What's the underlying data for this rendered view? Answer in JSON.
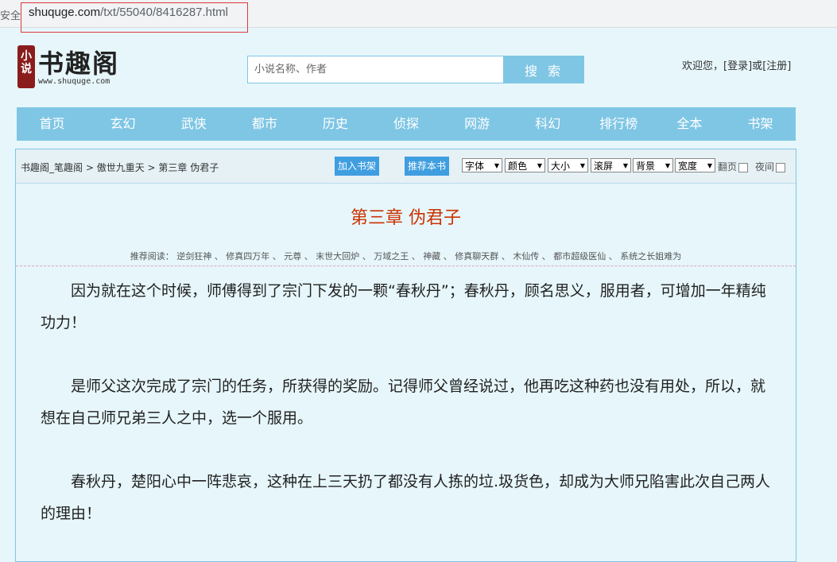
{
  "browser": {
    "security_label": "安全",
    "url_domain": "shuquge.com",
    "url_path": "/txt/55040/8416287.html"
  },
  "header": {
    "logo_seal": "小说",
    "logo_title": "书趣阁",
    "logo_url": "www.shuquge.com",
    "search_placeholder": "小说名称、作者",
    "search_button": "搜 索",
    "welcome": "欢迎您，",
    "login": "[登录]",
    "or": "或",
    "register": "[注册]"
  },
  "nav": [
    "首页",
    "玄幻",
    "武侠",
    "都市",
    "历史",
    "侦探",
    "网游",
    "科幻",
    "排行榜",
    "全本",
    "书架"
  ],
  "toolbar": {
    "crumb_site": "书趣阁_笔趣阁",
    "sep": " > ",
    "crumb_book": "傲世九重天",
    "crumb_chapter": "第三章 伪君子",
    "add_shelf": "加入书架",
    "recommend_book": "推荐本书",
    "selects": [
      "字体",
      "颜色",
      "大小",
      "滚屏",
      "背景",
      "宽度"
    ],
    "page_flip": "翻页",
    "night": "夜间"
  },
  "chapter": {
    "title": "第三章 伪君子",
    "recommend_label": "推荐阅读：",
    "recommend_books": [
      "逆剑狂神",
      "修真四万年",
      "元尊",
      "末世大回炉",
      "万域之王",
      "神藏",
      "修真聊天群",
      "木仙传",
      "都市超级医仙",
      "系统之长姐难为"
    ],
    "paragraphs": [
      "因为就在这个时候，师傅得到了宗门下发的一颗“春秋丹”；春秋丹，顾名思义，服用者，可增加一年精纯功力！",
      "是师父这次完成了宗门的任务，所获得的奖励。记得师父曾经说过，他再吃这种药也没有用处，所以，就想在自己师兄弟三人之中，选一个服用。",
      "春秋丹，楚阳心中一阵悲哀，这种在上三天扔了都没有人拣的垃.圾货色，却成为大师兄陷害此次自己两人的理由！"
    ]
  },
  "colors": {
    "accent": "#7fc6e4",
    "button_blue": "#3f9ee0",
    "chapter_title": "#cc3300",
    "background": "#e6f6fb"
  }
}
